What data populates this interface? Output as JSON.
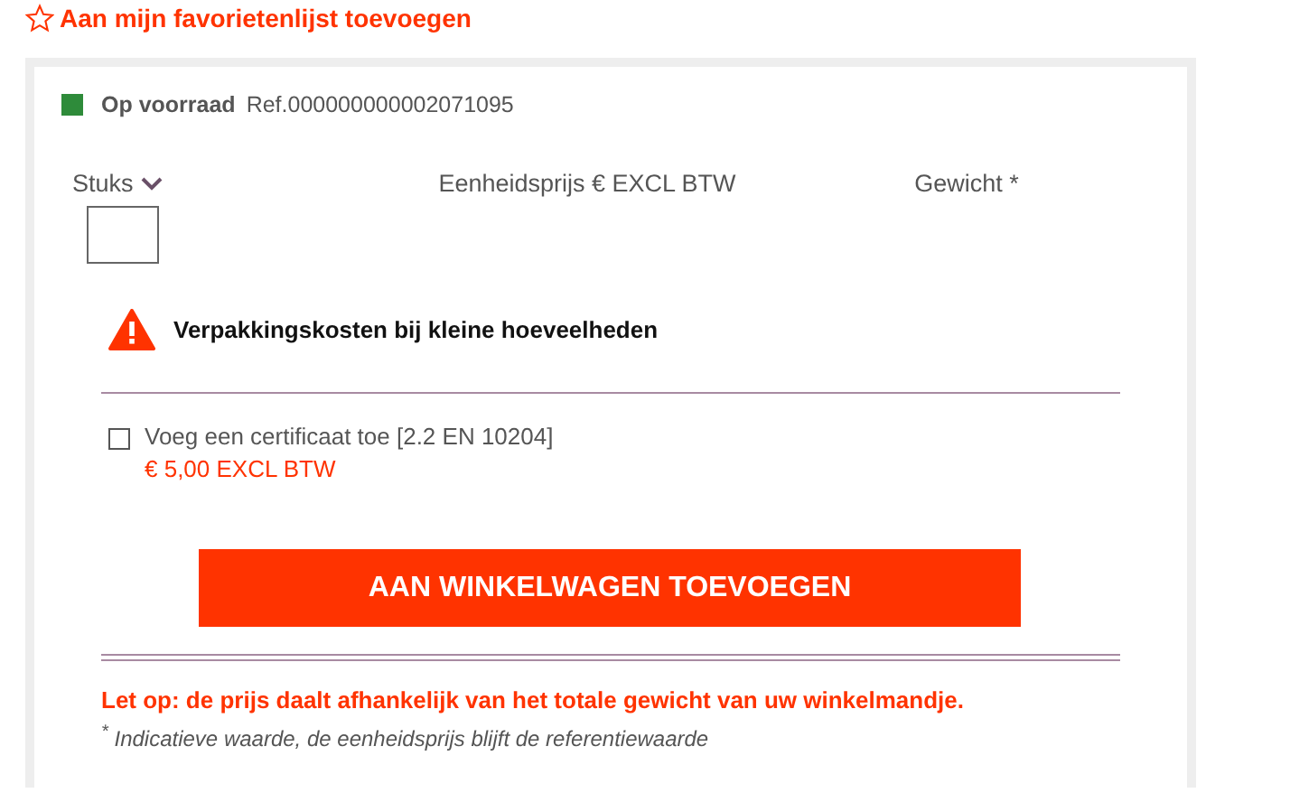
{
  "favorite_link": {
    "label": "Aan mijn favorietenlijst toevoegen"
  },
  "stock": {
    "label": "Op voorraad",
    "color": "#2e8b3a",
    "reference": "Ref.000000000002071095"
  },
  "columns": [
    {
      "label": "Stuks",
      "kind": "dropdown"
    },
    {
      "label": "Eenheidsprijs € EXCL BTW",
      "kind": "text"
    },
    {
      "label": "Gewicht *",
      "kind": "text"
    }
  ],
  "warning": {
    "text": "Verpakkingskosten bij kleine hoeveelheden"
  },
  "certificate": {
    "label": "Voeg een certificaat toe [2.2 EN 10204]",
    "price": "€ 5,00 EXCL BTW",
    "checked": false
  },
  "add_to_cart_button": {
    "label": "AAN WINKELWAGEN TOEVOEGEN"
  },
  "notice": "Let op: de prijs daalt afhankelijk van het totale gewicht van uw winkelmandje.",
  "footnote": "$^{*}$ Indicatieve waarde, de eenheidsprijs blijft de referentiewaarde"
}
